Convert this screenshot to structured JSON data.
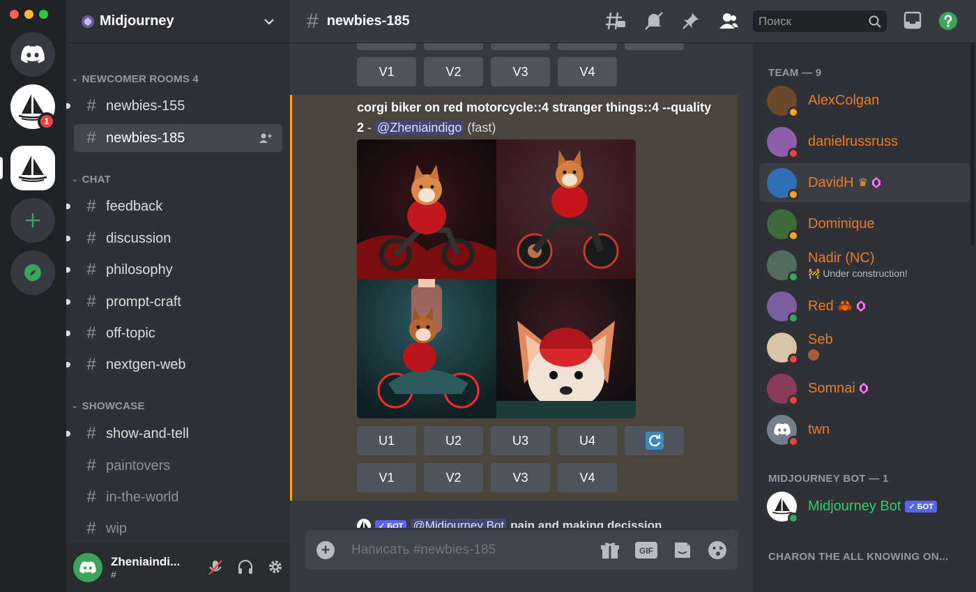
{
  "server": {
    "name": "Midjourney",
    "badge": "1"
  },
  "categories": {
    "newcomer": "NEWCOMER ROOMS 4",
    "chat": "CHAT",
    "showcase": "SHOWCASE"
  },
  "channels": {
    "newbies155": "newbies-155",
    "newbies185": "newbies-185",
    "feedback": "feedback",
    "discussion": "discussion",
    "philosophy": "philosophy",
    "promptcraft": "prompt-craft",
    "offtopic": "off-topic",
    "nextgenweb": "nextgen-web",
    "showandtell": "show-and-tell",
    "paintovers": "paintovers",
    "intheworld": "in-the-world",
    "wip": "wip"
  },
  "user": {
    "name": "Zheniaindi...",
    "tag": "#"
  },
  "topbar": {
    "channel": "newbies-185",
    "search_placeholder": "Поиск"
  },
  "message": {
    "prompt_bold": "corgi biker on red motorcycle::4 stranger things::4 --quality 2",
    "separator": " - ",
    "mention": "@Zheniaindigo",
    "speed": " (fast)"
  },
  "buttons_top": [
    "V1",
    "V2",
    "V3",
    "V4"
  ],
  "buttons_u": [
    "U1",
    "U2",
    "U3",
    "U4"
  ],
  "buttons_v": [
    "V1",
    "V2",
    "V3",
    "V4"
  ],
  "next_message": {
    "bot_label": "✓ БОТ",
    "mention": "@Midjourney Bot",
    "text": "pain and making decission"
  },
  "composer": {
    "placeholder": "Написать #newbies-185"
  },
  "members": {
    "team_header": "TEAM — 9",
    "team": [
      {
        "name": "AlexColgan",
        "sub": ""
      },
      {
        "name": "danielrussruss",
        "sub": ""
      },
      {
        "name": "DavidH",
        "sub": ""
      },
      {
        "name": "Dominique",
        "sub": ""
      },
      {
        "name": "Nadir (NC)",
        "sub": "🚧 Under construction!"
      },
      {
        "name": "Red",
        "sub": ""
      },
      {
        "name": "Seb",
        "sub": ""
      },
      {
        "name": "Somnai",
        "sub": ""
      },
      {
        "name": "twn",
        "sub": ""
      }
    ],
    "bot_header": "MIDJOURNEY BOT — 1",
    "bot": {
      "name": "Midjourney Bot",
      "tag": "✓ БОТ"
    },
    "charon_header": "CHARON THE ALL KNOWING ON..."
  },
  "colors": {
    "accent": "#5865f2",
    "member_orange": "#e67e22",
    "bot_green": "#2ecc71",
    "highlight": "#faa61a"
  }
}
